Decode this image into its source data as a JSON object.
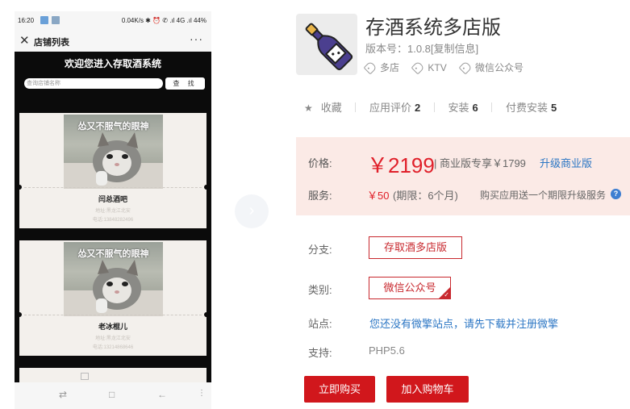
{
  "phone": {
    "status": {
      "time": "16:20",
      "right": "0.04K/s ✱ ⏰ ✆ .ıl 4G .ıl 44%"
    },
    "header": {
      "title": "店铺列表",
      "close_glyph": "✕",
      "more_glyph": "···"
    },
    "welcome": "欢迎您进入存取酒系统",
    "search": {
      "placeholder": "查询店铺名称",
      "button": "查 找"
    },
    "cards": [
      {
        "caption": "怂又不服气的眼神",
        "name": "闫总酒吧",
        "address": "地址:黑龙江北安",
        "tel": "电话:13848282496"
      },
      {
        "caption": "怂又不服气的眼神",
        "name": "老冰棍儿",
        "address": "地址:黑龙江北安",
        "tel": "电话:13214868646"
      }
    ],
    "nav": {
      "back": "⇄",
      "home": "□",
      "prev": "←",
      "menu": "⋮"
    }
  },
  "carousel": {
    "next_glyph": "›"
  },
  "product": {
    "title": "存酒系统多店版",
    "version": "版本号：1.0.8",
    "copy_info": "[复制信息]",
    "tags": [
      "多店",
      "KTV",
      "微信公众号"
    ],
    "stats": {
      "favorite": "收藏",
      "rating_label": "应用评价",
      "rating_value": "2",
      "install_label": "安装",
      "install_value": "6",
      "paid_label": "付费安装",
      "paid_value": "5"
    },
    "price": {
      "label": "价格:",
      "value": "￥2199",
      "business": "| 商业版专享￥1799",
      "upgrade": "升级商业版"
    },
    "service": {
      "label": "服务:",
      "value": "￥50",
      "period": "(期限：6个月)",
      "note": "购买应用送一个期限升级服务",
      "help": "?"
    },
    "branch": {
      "label": "分支:",
      "value": "存取酒多店版"
    },
    "category": {
      "label": "类别:",
      "value": "微信公众号"
    },
    "site": {
      "label": "站点:",
      "value": "您还没有微擎站点，请先下载并注册微擎"
    },
    "support": {
      "label": "支持:",
      "value": "PHP5.6"
    },
    "buttons": {
      "buy": "立即购买",
      "cart": "加入购物车"
    }
  },
  "colors": {
    "accent": "#d1171c",
    "link": "#2b76c4",
    "panel": "#fbeae6"
  }
}
